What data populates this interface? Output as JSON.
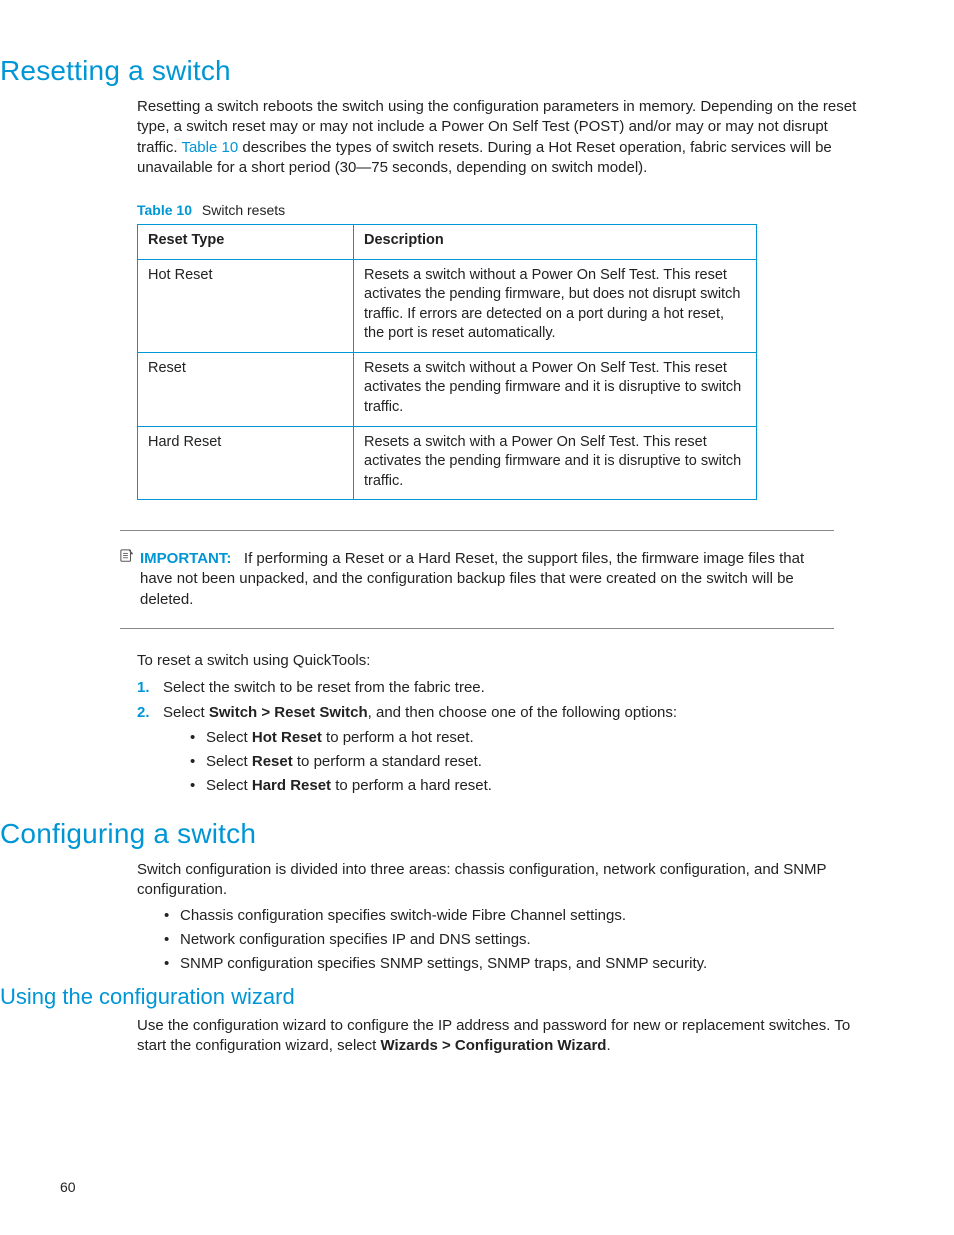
{
  "page_number": "60",
  "sections": {
    "resetting": {
      "title": "Resetting a switch",
      "intro_pre": "Resetting a switch reboots the switch using the configuration parameters in memory. Depending on the reset type, a switch reset may or may not include a Power On Self Test (POST) and/or may or may not disrupt traffic. ",
      "intro_link": "Table 10",
      "intro_post": " describes the types of switch resets. During a Hot Reset operation, fabric services will be unavailable for a short period (30—75 seconds, depending on switch model).",
      "table": {
        "label": "Table 10",
        "caption": "Switch resets",
        "headers": [
          "Reset Type",
          "Description"
        ],
        "rows": [
          {
            "type": "Hot Reset",
            "desc": "Resets a switch without a Power On Self Test. This reset activates the pending firmware, but does not disrupt switch traffic. If errors are detected on a port during a hot reset, the port is reset automatically."
          },
          {
            "type": "Reset",
            "desc": "Resets a switch without a Power On Self Test. This reset activates the pending firmware and it is disruptive to switch traffic."
          },
          {
            "type": "Hard Reset",
            "desc": "Resets a switch with a Power On Self Test. This reset activates the pending firmware and it is disruptive to switch traffic."
          }
        ]
      },
      "important": {
        "label": "IMPORTANT:",
        "text": "If performing a Reset or a Hard Reset, the support files, the firmware image files that have not been unpacked, and the configuration backup files that were created on the switch will be deleted."
      },
      "procedure_lead": "To reset a switch using QuickTools:",
      "steps": {
        "s1": "Select the switch to be reset from the fabric tree.",
        "s2_pre": "Select ",
        "s2_bold": "Switch > Reset Switch",
        "s2_post": ", and then choose one of the following options:",
        "sub": {
          "a_pre": "Select ",
          "a_bold": "Hot Reset",
          "a_post": " to perform a hot reset.",
          "b_pre": "Select ",
          "b_bold": "Reset",
          "b_post": " to perform a standard reset.",
          "c_pre": "Select ",
          "c_bold": "Hard Reset",
          "c_post": " to perform a hard reset."
        }
      }
    },
    "configuring": {
      "title": "Configuring a switch",
      "intro": "Switch configuration is divided into three areas: chassis configuration, network configuration, and SNMP configuration.",
      "bullets": [
        "Chassis configuration specifies switch-wide Fibre Channel settings.",
        "Network configuration specifies IP and DNS settings.",
        "SNMP configuration specifies SNMP settings, SNMP traps, and SNMP security."
      ]
    },
    "wizard": {
      "title": "Using the configuration wizard",
      "p_pre": "Use the configuration wizard to configure the IP address and password for new or replacement switches. To start the configuration wizard, select ",
      "p_bold": "Wizards > Configuration Wizard",
      "p_post": "."
    }
  },
  "step_numbers": {
    "one": "1.",
    "two": "2."
  }
}
